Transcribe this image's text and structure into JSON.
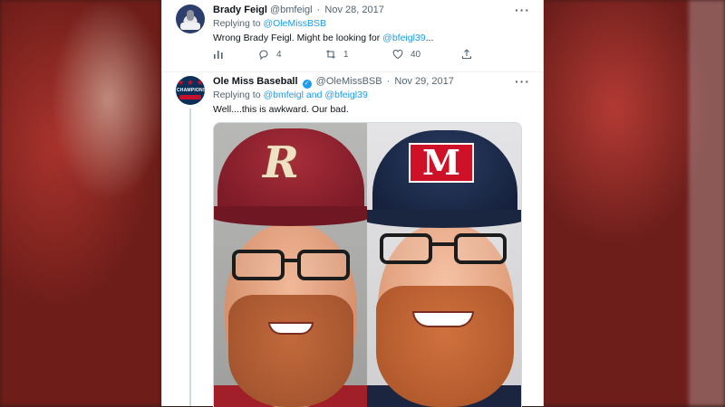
{
  "tweets": [
    {
      "name": "Brady Feigl",
      "handle": "@bmfeigl",
      "separator": "·",
      "date": "Nov 28, 2017",
      "replying_prefix": "Replying to",
      "replying_to": "@OleMissBSB",
      "body_prefix": "Wrong Brady Feigl. Might be looking for",
      "body_link": "@bfeigl39",
      "body_suffix": "...",
      "actions": {
        "analytics_icon": "analytics-icon",
        "reply_icon": "reply-icon",
        "replies": "4",
        "retweet_icon": "retweet-icon",
        "retweets": "1",
        "like_icon": "heart-icon",
        "likes": "40",
        "share_icon": "share-icon"
      }
    },
    {
      "name": "Ole Miss Baseball",
      "verified": true,
      "handle": "@OleMissBSB",
      "separator": "·",
      "date": "Nov 29, 2017",
      "replying_prefix": "Replying to",
      "replying_to_1": "@bmfeigl",
      "replying_and": "and",
      "replying_to_2": "@bfeigl39",
      "body": "Well....this is awkward. Our bad.",
      "avatar_text": "CHAMPIONS",
      "media_logos": {
        "left": "R",
        "right": "M"
      }
    }
  ],
  "more_label": "···",
  "colors": {
    "link": "#1d9bf0",
    "text": "#0f1419",
    "muted": "#536471"
  }
}
